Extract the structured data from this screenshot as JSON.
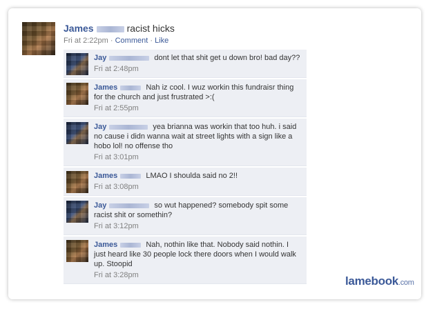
{
  "post": {
    "author": "James",
    "status": "racist hicks",
    "time": "Fri at 2:22pm",
    "sep1": " · ",
    "comment_link": "Comment",
    "sep2": " · ",
    "like_link": "Like"
  },
  "comments": [
    {
      "author": "Jay",
      "text": "dont let that shit get u down bro! bad day??",
      "time": "Fri at 2:48pm"
    },
    {
      "author": "James",
      "text": "Nah iz cool. I wuz workin this fundraisr thing for the church and just frustrated >:(",
      "time": "Fri at 2:55pm"
    },
    {
      "author": "Jay",
      "text": "yea brianna was workin that too huh. i said no cause i didn wanna wait at street lights with a sign like a hobo lol! no offense tho",
      "time": "Fri at 3:01pm"
    },
    {
      "author": "James",
      "text": "LMAO I shoulda said no 2!!",
      "time": "Fri at 3:08pm"
    },
    {
      "author": "Jay",
      "text": "so wut happened? somebody spit some racist shit or somethin?",
      "time": "Fri at 3:12pm"
    },
    {
      "author": "James",
      "text": "Nah, nothin like that. Nobody said nothin. I just heard like 30 people lock there doors when I would walk up. Stoopid",
      "time": "Fri at 3:28pm"
    }
  ],
  "watermark": {
    "brand": "lamebook",
    "domain": ".com"
  },
  "colors": {
    "link": "#3b5998",
    "comment_bg": "#edeff4",
    "meta": "#808080"
  }
}
